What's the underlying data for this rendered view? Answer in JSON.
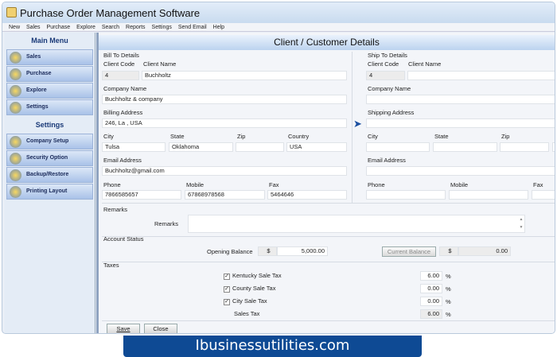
{
  "app": {
    "title": "Purchase Order Management Software"
  },
  "menu": [
    "New",
    "Sales",
    "Purchase",
    "Explore",
    "Search",
    "Reports",
    "Settings",
    "Send Email",
    "Help"
  ],
  "sidebar": {
    "main_title": "Main Menu",
    "main_items": [
      "Sales",
      "Purchase",
      "Explore",
      "Settings"
    ],
    "settings_title": "Settings",
    "settings_items": [
      "Company Setup",
      "Security Option",
      "Backup/Restore",
      "Printing Layout"
    ]
  },
  "page_title": "Client / Customer Details",
  "bill": {
    "section": "Bill To Details",
    "client_code_label": "Client Code",
    "client_name_label": "Client Name",
    "client_code": "4",
    "client_name": "Buchholtz",
    "company_label": "Company Name",
    "company": "Buchholtz & company",
    "address_label": "Billing Address",
    "address": "246, La , USA",
    "city_label": "City",
    "state_label": "State",
    "zip_label": "Zip",
    "country_label": "Country",
    "city": "Tulsa",
    "state": "Oklahoma",
    "zip": "",
    "country": "USA",
    "email_label": "Email Address",
    "email": "Buchholtz@gmail.com",
    "phone_label": "Phone",
    "mobile_label": "Mobile",
    "fax_label": "Fax",
    "phone": "7866585657",
    "mobile": "67868978568",
    "fax": "5464646"
  },
  "ship": {
    "section": "Ship To Details",
    "client_code_label": "Client Code",
    "client_name_label": "Client Name",
    "client_code": "4",
    "company_label": "Company Name",
    "address_label": "Shipping Address",
    "city_label": "City",
    "state_label": "State",
    "zip_label": "Zip",
    "email_label": "Email Address",
    "phone_label": "Phone",
    "mobile_label": "Mobile",
    "fax_label": "Fax"
  },
  "remarks": {
    "section": "Remarks",
    "label": "Remarks",
    "value": ""
  },
  "account": {
    "section": "Account Status",
    "opening_label": "Opening Balance",
    "currency": "$",
    "opening": "5,000.00",
    "current_button": "Current Balance",
    "current": "0.00"
  },
  "taxes": {
    "section": "Taxes",
    "items": [
      {
        "label": "Kentucky Sale Tax",
        "value": "6.00",
        "checked": true
      },
      {
        "label": "County Sale Tax",
        "value": "0.00",
        "checked": true
      },
      {
        "label": "City Sale Tax",
        "value": "0.00",
        "checked": true
      }
    ],
    "total_label": "Sales Tax",
    "total": "6.00",
    "unit": "%"
  },
  "buttons": {
    "save": "Save",
    "close": "Close"
  },
  "banner": "Ibusinessutilities.com"
}
